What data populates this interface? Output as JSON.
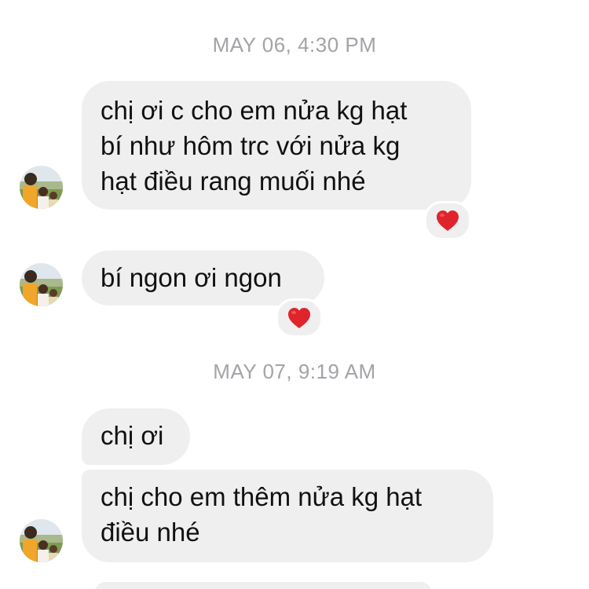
{
  "conversation": {
    "groups": [
      {
        "timestamp": "MAY 06, 4:30 PM",
        "messages": [
          {
            "text": "chị ơi c cho em nửa kg hạt\nbí như hôm trc với nửa kg\nhạt điều rang muối nhé",
            "reaction": "heart-icon"
          },
          {
            "text": "bí ngon ơi ngon",
            "reaction": "heart-icon"
          }
        ]
      },
      {
        "timestamp": "MAY 07, 9:19 AM",
        "messages": [
          {
            "text": "chị ơi",
            "reaction": null
          },
          {
            "text": "chị cho em thêm nửa kg hạt\nđiều nhé",
            "reaction": null
          }
        ]
      }
    ]
  },
  "colors": {
    "bubble_background": "#efefef",
    "timestamp_text": "#a3a3a8",
    "message_text": "#111111",
    "reaction_heart": "#e0242b"
  }
}
